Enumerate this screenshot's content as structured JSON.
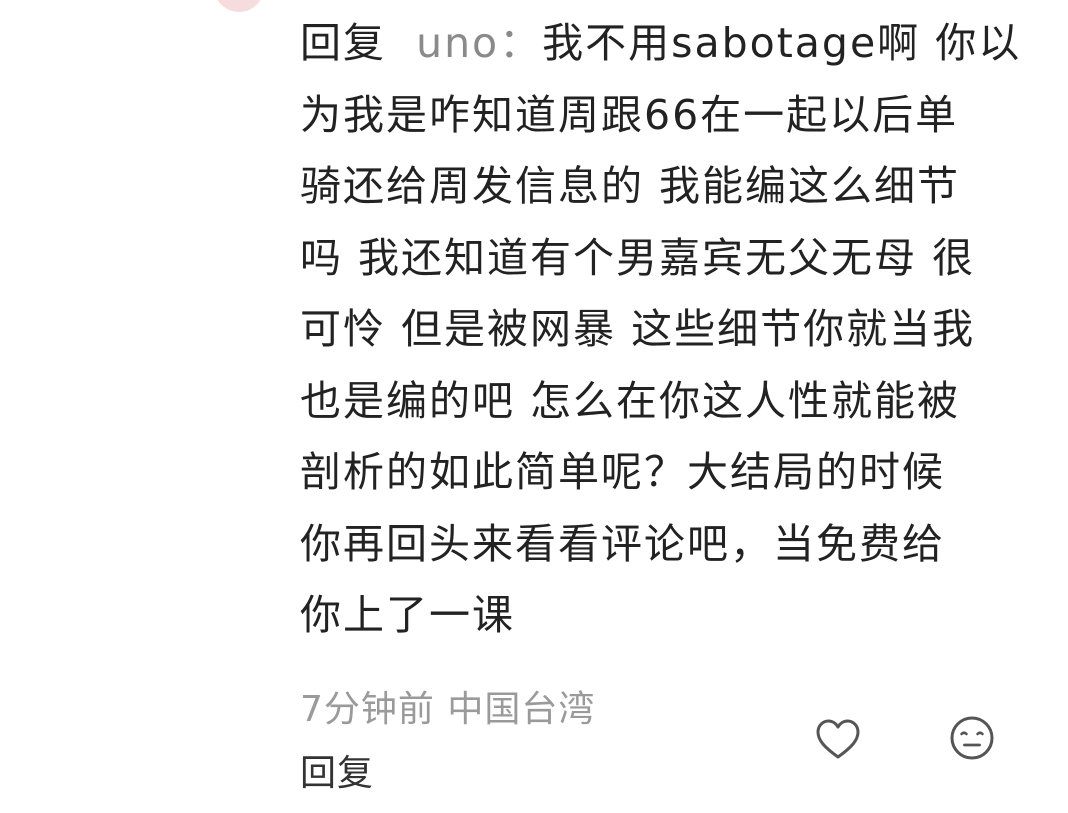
{
  "comment": {
    "reply_prefix": "回复",
    "reply_to_user": "uno",
    "reply_separator": "：",
    "lines": [
      "我不用sabotage啊 你以",
      "为我是咋知道周跟66在一起以后单",
      "骑还给周发信息的 我能编这么细节",
      "吗 我还知道有个男嘉宾无父无母 很",
      "可怜 但是被网暴 这些细节你就当我",
      "也是编的吧 怎么在你这人性就能被",
      "剖析的如此简单呢？大结局的时候",
      "你再回头来看看评论吧，当免费给",
      "你上了一课"
    ]
  },
  "meta": {
    "time": "7分钟前",
    "location": "中国台湾"
  },
  "actions": {
    "reply_label": "回复",
    "like_icon": "heart-outline-icon",
    "dislike_icon": "neutral-face-icon"
  },
  "colors": {
    "text": "#222222",
    "muted": "#9a9a9a",
    "avatar": "#f6dcdc"
  }
}
